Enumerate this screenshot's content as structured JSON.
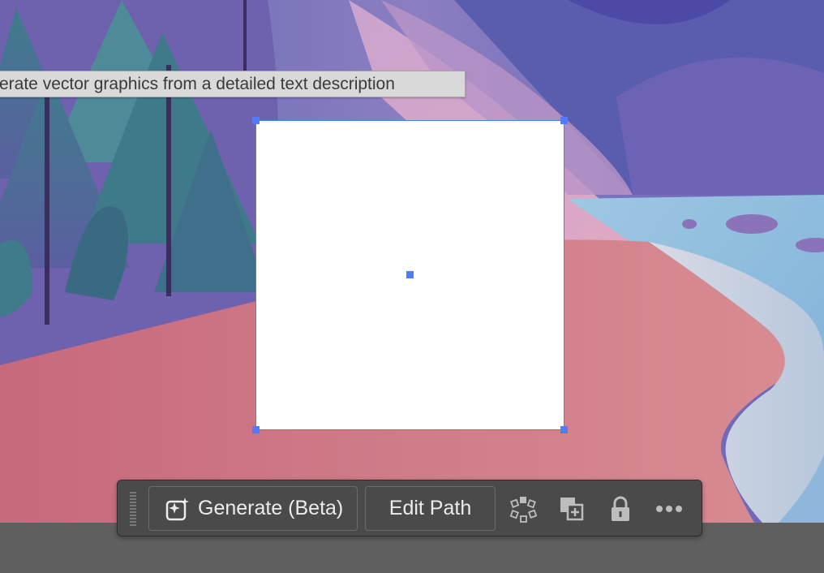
{
  "tooltip": {
    "text": "erate vector graphics from a detailed text description"
  },
  "toolbar": {
    "generate_label": "Generate (Beta)",
    "edit_path_label": "Edit Path",
    "icons": [
      "generate-sparkle-icon",
      "recolor-icon",
      "duplicate-icon",
      "lock-icon",
      "more-options-icon"
    ]
  },
  "colors": {
    "selection_accent": "#4f7bff",
    "toolbar_bg": "#4a4a4a",
    "pasteboard": "#5f5f5f"
  }
}
